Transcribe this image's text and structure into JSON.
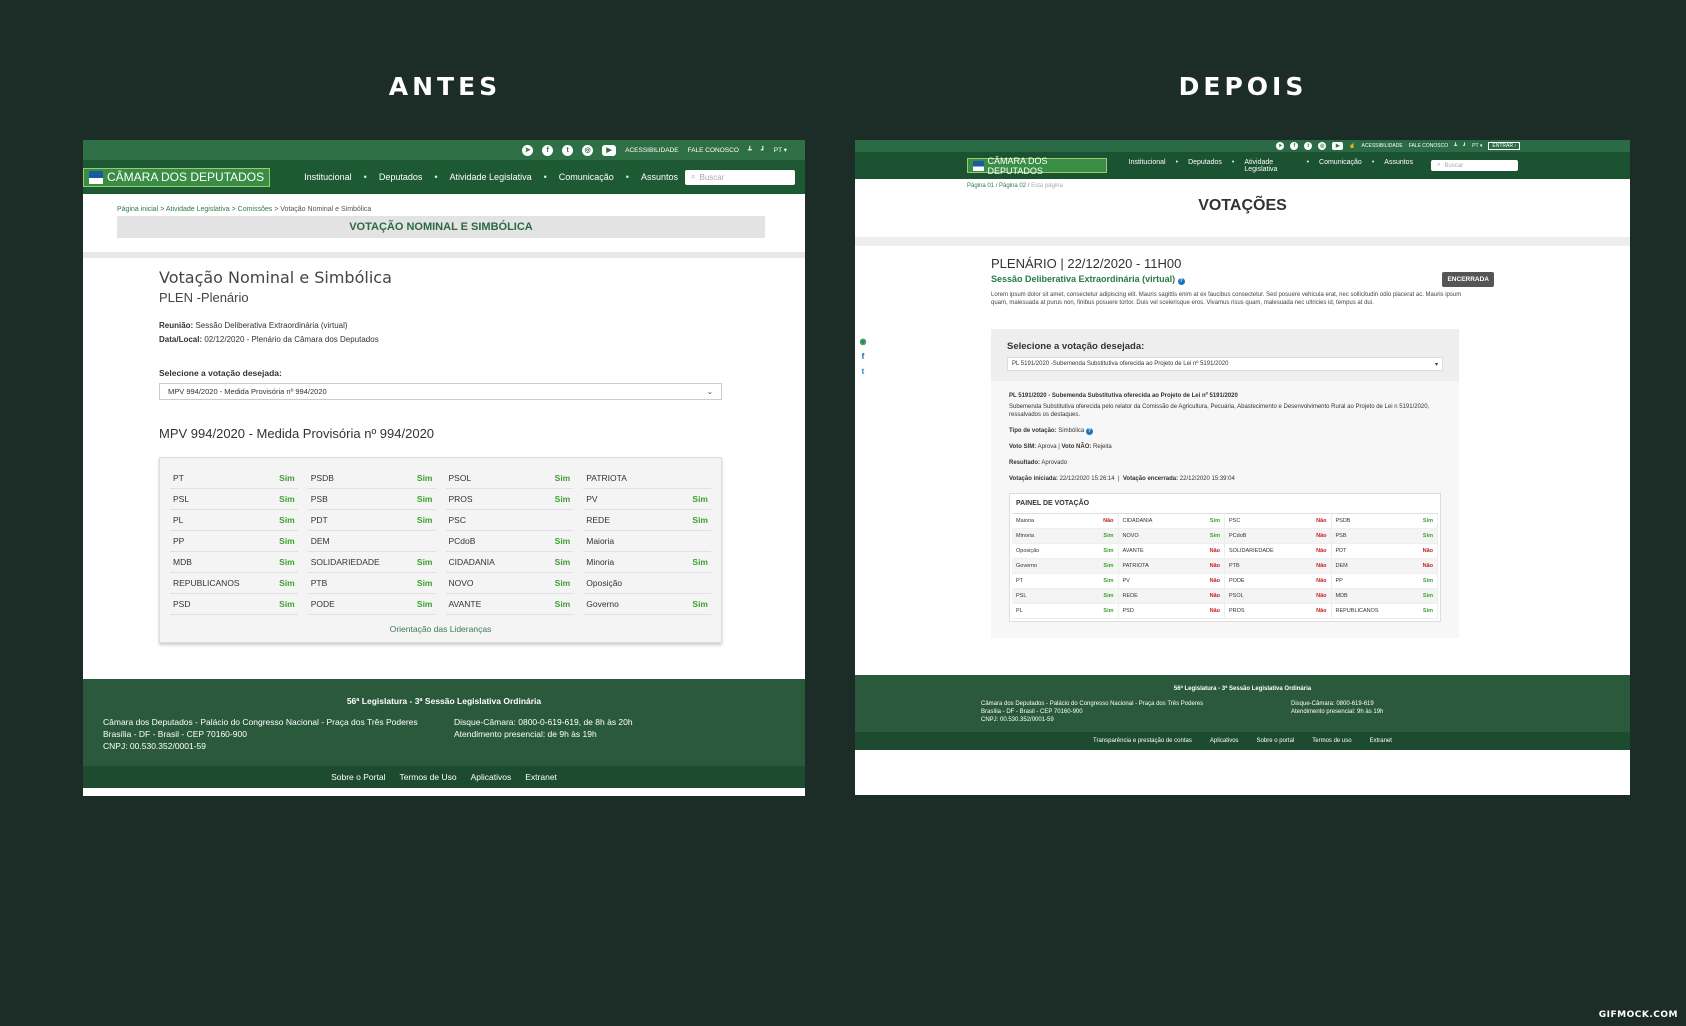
{
  "labels": {
    "before": "ANTES",
    "after": "DEPOIS",
    "watermark": "GIFMOCK.COM"
  },
  "colors": {
    "bg": "#1c2d28",
    "green_dark": "#1d5a34",
    "green_top": "#2f6f46",
    "sim": "#3ca02f",
    "nao": "#c41f1f"
  },
  "header": {
    "top_links": [
      "ACESSIBILIDADE",
      "FALE CONOSCO",
      "PT ▾"
    ],
    "top_links_after": [
      "ACESSIBILIDADE",
      "FALE CONOSCO",
      "PT ▾",
      "ENTRAR ›"
    ],
    "logo": "CÂMARA DOS DEPUTADOS",
    "nav": [
      "Institucional",
      "Deputados",
      "Atividade Legislativa",
      "Comunicação",
      "Assuntos"
    ],
    "search_placeholder": "Buscar"
  },
  "before": {
    "crumb": [
      "Página inicial",
      "Atividade Legislativa",
      "Comissões",
      "Votação Nominal e Simbólica"
    ],
    "banner": "VOTAÇÃO NOMINAL E SIMBÓLICA",
    "title": "Votação Nominal e Simbólica",
    "subtitle": "PLEN -Plenário",
    "reuniao_label": "Reunião:",
    "reuniao": "Sessão Deliberativa Extraordinária (virtual)",
    "data_label": "Data/Local:",
    "data": "02/12/2020 - Plenário da Câmara dos Deputados",
    "select_label": "Selecione a votação desejada:",
    "select_value": "MPV 994/2020 - Medida Provisória nº 994/2020",
    "heading": "MPV 994/2020 - Medida Provisória nº 994/2020",
    "parties": [
      [
        "PT",
        "Sim"
      ],
      [
        "PSDB",
        "Sim"
      ],
      [
        "PSOL",
        "Sim"
      ],
      [
        "PATRIOTA",
        ""
      ],
      [
        "PSL",
        "Sim"
      ],
      [
        "PSB",
        "Sim"
      ],
      [
        "PROS",
        "Sim"
      ],
      [
        "PV",
        "Sim"
      ],
      [
        "PL",
        "Sim"
      ],
      [
        "PDT",
        "Sim"
      ],
      [
        "PSC",
        ""
      ],
      [
        "REDE",
        "Sim"
      ],
      [
        "PP",
        "Sim"
      ],
      [
        "DEM",
        ""
      ],
      [
        "PCdoB",
        "Sim"
      ],
      [
        "Maioria",
        ""
      ],
      [
        "MDB",
        "Sim"
      ],
      [
        "SOLIDARIEDADE",
        "Sim"
      ],
      [
        "CIDADANIA",
        "Sim"
      ],
      [
        "Minoria",
        "Sim"
      ],
      [
        "REPUBLICANOS",
        "Sim"
      ],
      [
        "PTB",
        "Sim"
      ],
      [
        "NOVO",
        "Sim"
      ],
      [
        "Oposição",
        ""
      ],
      [
        "PSD",
        "Sim"
      ],
      [
        "PODE",
        "Sim"
      ],
      [
        "AVANTE",
        "Sim"
      ],
      [
        "Governo",
        "Sim"
      ]
    ],
    "link": "Orientação das Lideranças",
    "footer": {
      "legislatura": "56ª Legislatura - 3ª Sessão Legislativa Ordinária",
      "address": [
        "Câmara dos Deputados - Palácio do Congresso Nacional - Praça dos Três Poderes",
        "Brasília - DF - Brasil - CEP 70160-900",
        "CNPJ: 00.530.352/0001-59"
      ],
      "contact": [
        "Disque-Câmara: 0800-0-619-619, de 8h às 20h",
        "Atendimento presencial: de 9h às 19h"
      ],
      "links": [
        "Sobre o Portal",
        "Termos de Uso",
        "Aplicativos",
        "Extranet"
      ]
    }
  },
  "after": {
    "crumb": [
      "Página 01",
      "Página 02",
      "Esta página"
    ],
    "page_title": "VOTAÇÕES",
    "title": "PLENÁRIO | 22/12/2020 - 11H00",
    "session": "Sessão Deliberativa Extraordinária (virtual)",
    "badge": "ENCERRADA",
    "lorem": "Lorem ipsum dolor sit amet, consectetur adipiscing elit. Mauris sagittis enim at ex faucibus consectetur. Sed posuere vehicula erat, nec sollicitudin odio placerat ac. Mauris ipsum quam, malesuada at purus non, finibus posuere tortor. Duis vel scelerisque eros. Vivamus risus quam, malesuada nec ultricies id, tempus at dui.",
    "select_label": "Selecione a votação desejada:",
    "select_value": "PL 5191/2020 -Subemenda Substitutiva oferecida ao Projeto de Lei nº 5191/2020",
    "vote_title": "PL 5191/2020 - Subemenda Substitutiva oferecida ao Projeto de Lei nº 5191/2020",
    "vote_desc": "Subemenda Substitutiva oferecida pelo relator da Comissão de Agricultura, Pecuária, Abastecimento e Desenvolvimento Rural ao Projeto de Lei n 5191/2020, ressalvados os destaques.",
    "tipo_label": "Tipo de votação:",
    "tipo": "Simbólica",
    "voto_sim_label": "Voto SIM:",
    "voto_sim": "Aprova",
    "voto_nao_label": "Voto NÃO:",
    "voto_nao": "Rejeita",
    "resultado_label": "Resultado:",
    "resultado": "Aprovado",
    "inicio_label": "Votação iniciada:",
    "inicio": "22/12/2020 15:26:14",
    "fim_label": "Votação encerrada:",
    "fim": "22/12/2020 15:39:04",
    "panel_title": "PAINEL DE VOTAÇÃO",
    "panel": [
      [
        "Maioria",
        "Não"
      ],
      [
        "CIDADANIA",
        "Sim"
      ],
      [
        "PSC",
        "Não"
      ],
      [
        "PSDB",
        "Sim"
      ],
      [
        "Minoria",
        "Sim"
      ],
      [
        "NOVO",
        "Sim"
      ],
      [
        "PCdoB",
        "Não"
      ],
      [
        "PSB",
        "Sim"
      ],
      [
        "Oposição",
        "Sim"
      ],
      [
        "AVANTE",
        "Não"
      ],
      [
        "SOLIDARIEDADE",
        "Não"
      ],
      [
        "PDT",
        "Não"
      ],
      [
        "Governo",
        "Sim"
      ],
      [
        "PATRIOTA",
        "Não"
      ],
      [
        "PTB",
        "Não"
      ],
      [
        "DEM",
        "Não"
      ],
      [
        "PT",
        "Sim"
      ],
      [
        "PV",
        "Não"
      ],
      [
        "PODE",
        "Não"
      ],
      [
        "PP",
        "Sim"
      ],
      [
        "PSL",
        "Sim"
      ],
      [
        "REDE",
        "Não"
      ],
      [
        "PSOL",
        "Não"
      ],
      [
        "MDB",
        "Sim"
      ],
      [
        "PL",
        "Sim"
      ],
      [
        "PSD",
        "Não"
      ],
      [
        "PROS",
        "Não"
      ],
      [
        "REPUBLICANOS",
        "Sim"
      ]
    ],
    "footer": {
      "legislatura": "56ª Legislatura - 3ª Sessão Legislativa Ordinária",
      "address": [
        "Câmara dos Deputados - Palácio do Congresso Nacional - Praça dos Três Poderes",
        "Brasília - DF - Brasil - CEP 70160-900",
        "CNPJ: 00.530.352/0001-59"
      ],
      "contact": [
        "Disque-Câmara: 0800-619-619",
        "Atendimento presencial: 9h às 19h"
      ],
      "links": [
        "Transparência e prestação de contas",
        "Aplicativos",
        "Sobre o portal",
        "Termos de uso",
        "Extranet"
      ]
    }
  }
}
